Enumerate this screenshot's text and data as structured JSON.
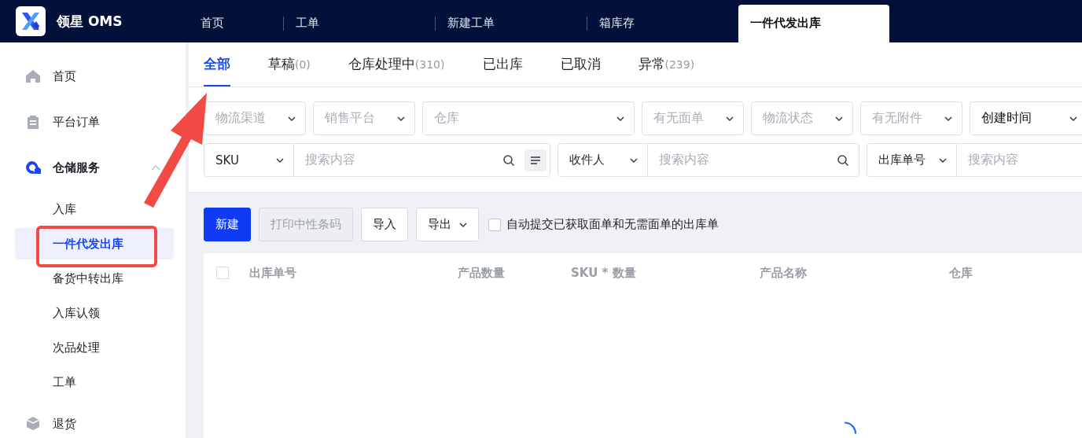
{
  "app": {
    "title": "领星 OMS"
  },
  "top_tabs": [
    {
      "label": "首页",
      "selected": false
    },
    {
      "label": "工单",
      "selected": false
    },
    {
      "label": "新建工单",
      "selected": false
    },
    {
      "label": "箱库存",
      "selected": false
    },
    {
      "label": "一件代发出库",
      "selected": true
    }
  ],
  "sidebar": {
    "items": [
      {
        "label": "首页",
        "selected": false
      },
      {
        "label": "平台订单",
        "selected": false
      },
      {
        "label": "仓储服务",
        "selected": false,
        "expanded": true,
        "children": [
          {
            "label": "入库",
            "selected": false
          },
          {
            "label": "一件代发出库",
            "selected": true
          },
          {
            "label": "备货中转出库",
            "selected": false
          },
          {
            "label": "入库认领",
            "selected": false
          },
          {
            "label": "次品处理",
            "selected": false
          },
          {
            "label": "工单",
            "selected": false
          }
        ]
      },
      {
        "label": "退货",
        "selected": false
      }
    ]
  },
  "status_tabs": [
    {
      "label": "全部",
      "selected": true
    },
    {
      "label": "草稿",
      "count": "(0)",
      "selected": false
    },
    {
      "label": "仓库处理中",
      "count": "(310)",
      "selected": false
    },
    {
      "label": "已出库",
      "selected": false
    },
    {
      "label": "已取消",
      "selected": false
    },
    {
      "label": "异常",
      "count": "(239)",
      "selected": false
    }
  ],
  "filters": [
    {
      "placeholder": "物流渠道"
    },
    {
      "placeholder": "销售平台"
    },
    {
      "placeholder": "仓库"
    },
    {
      "placeholder": "有无面单"
    },
    {
      "placeholder": "物流状态"
    },
    {
      "placeholder": "有无附件"
    },
    {
      "value": "创建时间"
    }
  ],
  "searches": [
    {
      "field": "SKU",
      "placeholder": "搜索内容",
      "search_icon": true,
      "list_toggle": true
    },
    {
      "field": "收件人",
      "placeholder": "搜索内容",
      "search_icon": true,
      "list_toggle": false
    },
    {
      "field": "出库单号",
      "placeholder": "搜索内容",
      "search_icon": false,
      "list_toggle": false
    }
  ],
  "actions": [
    {
      "label": "新建",
      "kind": "primary",
      "disabled": false
    },
    {
      "label": "打印中性条码",
      "kind": "default",
      "disabled": true
    },
    {
      "label": "导入",
      "kind": "default",
      "disabled": false
    },
    {
      "label": "导出",
      "kind": "dropdown",
      "disabled": false
    }
  ],
  "auto_submit": {
    "label": "自动提交已获取面单和无需面单的出库单",
    "checked": false
  },
  "table": {
    "columns": [
      "出库单号",
      "产品数量",
      "SKU * 数量",
      "产品名称",
      "仓库"
    ],
    "loading": true
  }
}
